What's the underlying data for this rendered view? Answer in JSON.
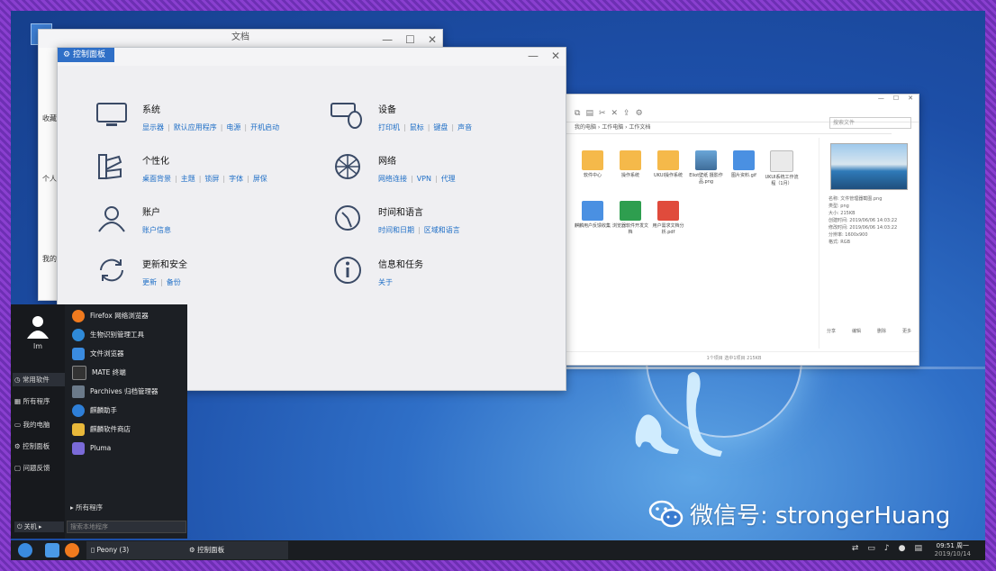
{
  "doc_window": {
    "title": "文档",
    "sidebar": [
      "收藏",
      "个人",
      "我的"
    ],
    "controls": [
      "—",
      "☐",
      "✕"
    ]
  },
  "control_panel": {
    "tab_label": "控制面板",
    "controls": [
      "—",
      "✕"
    ],
    "items": [
      {
        "title": "系统",
        "links": [
          "显示器",
          "默认应用程序",
          "电源",
          "开机启动"
        ]
      },
      {
        "title": "设备",
        "links": [
          "打印机",
          "鼠标",
          "键盘",
          "声音"
        ]
      },
      {
        "title": "个性化",
        "links": [
          "桌面背景",
          "主题",
          "锁屏",
          "字体",
          "屏保"
        ]
      },
      {
        "title": "网络",
        "links": [
          "网络连接",
          "VPN",
          "代理"
        ]
      },
      {
        "title": "账户",
        "links": [
          "账户信息"
        ]
      },
      {
        "title": "时间和语言",
        "links": [
          "时间和日期",
          "区域和语言"
        ]
      },
      {
        "title": "更新和安全",
        "links": [
          "更新",
          "备份"
        ]
      },
      {
        "title": "信息和任务",
        "links": [
          "关于"
        ]
      }
    ]
  },
  "file_manager": {
    "search_placeholder": "搜索文件",
    "path": "我的电脑 › 工作电脑 › 工作文档",
    "files": [
      {
        "name": "软件中心",
        "type": "folder"
      },
      {
        "name": "操作系统",
        "type": "folder"
      },
      {
        "name": "UKUI操作系统",
        "type": "folder"
      },
      {
        "name": "Eliot壁纸 摄影作品.png",
        "type": "img"
      },
      {
        "name": "图片资料.gif",
        "type": "doc"
      },
      {
        "name": "UKUI系统工作流程（1月）",
        "type": "txt"
      },
      {
        "name": "麒麟用户反馈收集",
        "type": "doc"
      },
      {
        "name": "浏览器软件开发文档",
        "type": "xls"
      },
      {
        "name": "用户需求文档分析.pdf",
        "type": "pdf"
      }
    ],
    "preview_props": [
      "名称:  文件管理器截图.png",
      "类型:  png",
      "大小:  215KB",
      "创建时间:  2019/06/06 14:03:22",
      "修改时间:  2019/06/06 14:03:22",
      "分辨率:  1600x900",
      "格式:  RGB"
    ],
    "preview_actions": [
      "分享",
      "编辑",
      "删除",
      "更多"
    ],
    "status": "1个项目    选中1项目    215KB"
  },
  "start_menu": {
    "username": "lm",
    "categories": [
      "常用软件",
      "所有程序",
      "我的电脑",
      "控制面板",
      "问题反馈"
    ],
    "apps": [
      {
        "label": "Firefox 网络浏览器",
        "color": "#f07a1e"
      },
      {
        "label": "生物识别管理工具",
        "color": "#2f8ad8"
      },
      {
        "label": "文件浏览器",
        "color": "#3a8be0"
      },
      {
        "label": "MATE 终端",
        "color": "#333333"
      },
      {
        "label": "Parchives 归档管理器",
        "color": "#6b7a8a"
      },
      {
        "label": "麒麟助手",
        "color": "#2e7fd8"
      },
      {
        "label": "麒麟软件商店",
        "color": "#e8b83a"
      },
      {
        "label": "Pluma",
        "color": "#7a6ad8"
      }
    ],
    "all_programs": "所有程序",
    "search_placeholder": "搜索本地程序",
    "power": "关机"
  },
  "taskbar": {
    "tasks": [
      "Peony (3)",
      "控制面板"
    ],
    "clock_time": "09:51 周一",
    "clock_date": "2019/10/14"
  },
  "watermark": "微信号: strongerHuang"
}
